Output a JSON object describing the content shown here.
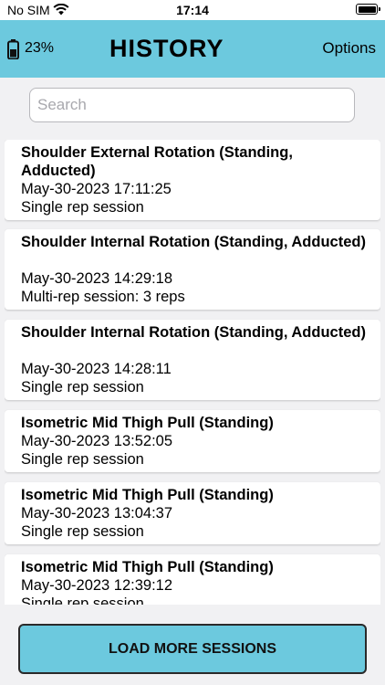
{
  "status_bar": {
    "carrier": "No SIM",
    "time": "17:14"
  },
  "header": {
    "device_battery": "23%",
    "title": "HISTORY",
    "options_label": "Options",
    "accent_color": "#6cc9de"
  },
  "search": {
    "placeholder": "Search",
    "value": ""
  },
  "sessions": [
    {
      "name": "Shoulder External Rotation (Standing, Adducted)",
      "datetime": "May-30-2023 17:11:25",
      "type": "Single rep session"
    },
    {
      "name": "Shoulder Internal Rotation (Standing, Adducted)",
      "datetime": "May-30-2023 14:29:18",
      "type": "Multi-rep session: 3 reps"
    },
    {
      "name": "Shoulder Internal Rotation (Standing, Adducted)",
      "datetime": "May-30-2023 14:28:11",
      "type": "Single rep session"
    },
    {
      "name": "Isometric Mid Thigh Pull (Standing)",
      "datetime": "May-30-2023 13:52:05",
      "type": "Single rep session"
    },
    {
      "name": "Isometric Mid Thigh Pull (Standing)",
      "datetime": "May-30-2023 13:04:37",
      "type": "Single rep session"
    },
    {
      "name": "Isometric Mid Thigh Pull (Standing)",
      "datetime": "May-30-2023 12:39:12",
      "type": "Single rep session"
    }
  ],
  "footer": {
    "load_more_label": "LOAD MORE SESSIONS"
  }
}
